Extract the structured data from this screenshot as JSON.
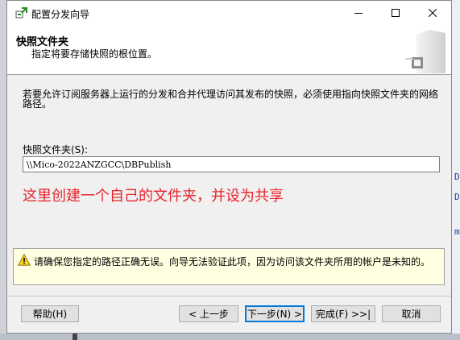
{
  "window": {
    "title": "配置分发向导",
    "controls": {
      "minimize": "minimize-icon",
      "maximize": "maximize-icon",
      "close": "close-icon"
    }
  },
  "header": {
    "title": "快照文件夹",
    "subtitle": "指定将要存储快照的根位置。"
  },
  "body": {
    "description": "若要允许订阅服务器上运行的分发和合并代理访问其发布的快照，必须使用指向快照文件夹的网络路径。",
    "folder_label": "快照文件夹(S):",
    "folder_value": "\\\\Mico-2022ANZGCC\\DBPublish",
    "annotation": "这里创建一个自己的文件夹，并设为共享"
  },
  "warning": {
    "icon": "warning-icon",
    "text": "请确保您指定的路径正确无误。向导无法验证此项，因为访问该文件夹所用的帐户是未知的。"
  },
  "buttons": {
    "help": "帮助(H)",
    "back": "< 上一步",
    "next": "下一步(N) >",
    "finish": "完成(F) >>|",
    "cancel": "取消"
  },
  "colors": {
    "annotation": "#e8232c",
    "warning_bg": "#ffffe1",
    "default_button_border": "#0078d7"
  }
}
